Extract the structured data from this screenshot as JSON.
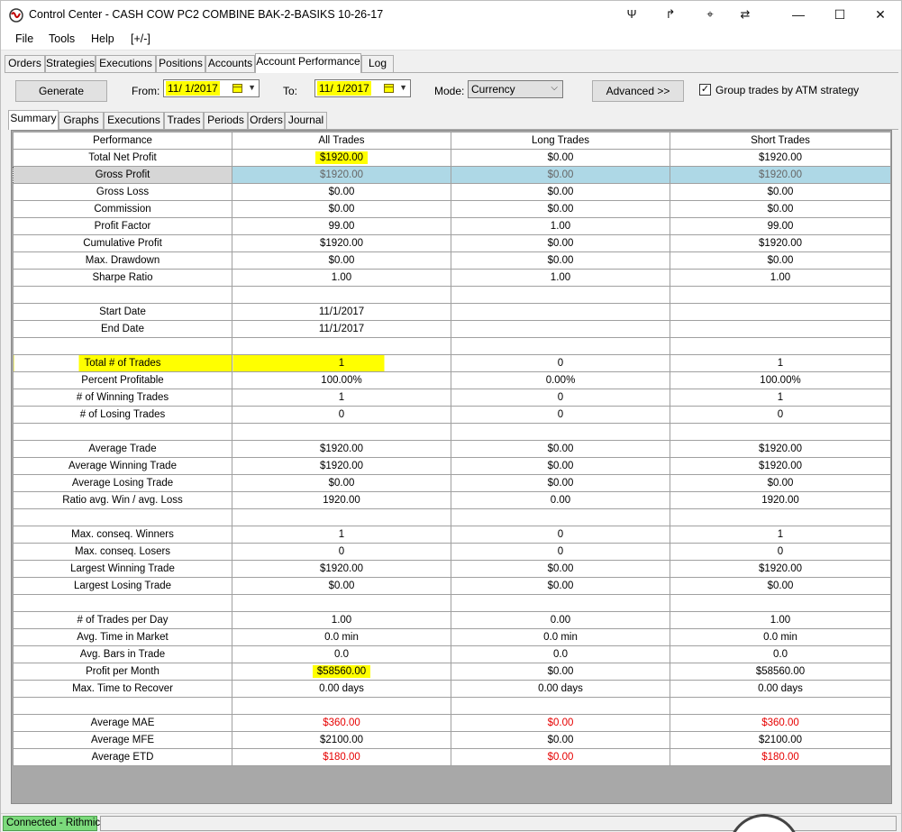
{
  "window": {
    "title": "Control Center - CASH COW PC2 COMBINE BAK-2-BASIKS 10-26-17",
    "tools": [
      "Ψ",
      "↱",
      "⌖",
      "⇄"
    ],
    "controls": {
      "minimize": "—",
      "maximize": "☐",
      "close": "✕"
    }
  },
  "menu": [
    "File",
    "Tools",
    "Help",
    "[+/-]"
  ],
  "main_tabs": [
    "Orders",
    "Strategies",
    "Executions",
    "Positions",
    "Accounts",
    "Account Performance",
    "Log"
  ],
  "toolbar": {
    "generate": "Generate",
    "from_label": "From:",
    "from_value": "11/ 1/2017",
    "to_label": "To:",
    "to_value": "11/ 1/2017",
    "mode_label": "Mode:",
    "mode_value": "Currency",
    "advanced": "Advanced >>",
    "group_label": "Group trades by ATM strategy",
    "group_checked": "✓"
  },
  "sub_tabs": [
    "Summary",
    "Graphs",
    "Executions",
    "Trades",
    "Periods",
    "Orders",
    "Journal"
  ],
  "table": {
    "headers": [
      "Performance",
      "All Trades",
      "Long Trades",
      "Short Trades"
    ],
    "rows": [
      [
        "Total Net Profit",
        "$1920.00",
        "$0.00",
        "$1920.00"
      ],
      [
        "Gross Profit",
        "$1920.00",
        "$0.00",
        "$1920.00"
      ],
      [
        "Gross Loss",
        "$0.00",
        "$0.00",
        "$0.00"
      ],
      [
        "Commission",
        "$0.00",
        "$0.00",
        "$0.00"
      ],
      [
        "Profit Factor",
        "99.00",
        "1.00",
        "99.00"
      ],
      [
        "Cumulative Profit",
        "$1920.00",
        "$0.00",
        "$1920.00"
      ],
      [
        "Max. Drawdown",
        "$0.00",
        "$0.00",
        "$0.00"
      ],
      [
        "Sharpe Ratio",
        "1.00",
        "1.00",
        "1.00"
      ],
      [
        "",
        "",
        "",
        ""
      ],
      [
        "Start Date",
        "11/1/2017",
        "",
        ""
      ],
      [
        "End Date",
        "11/1/2017",
        "",
        ""
      ],
      [
        "",
        "",
        "",
        ""
      ],
      [
        "Total # of Trades",
        "1",
        "0",
        "1"
      ],
      [
        "Percent Profitable",
        "100.00%",
        "0.00%",
        "100.00%"
      ],
      [
        "# of Winning Trades",
        "1",
        "0",
        "1"
      ],
      [
        "# of Losing Trades",
        "0",
        "0",
        "0"
      ],
      [
        "",
        "",
        "",
        ""
      ],
      [
        "Average Trade",
        "$1920.00",
        "$0.00",
        "$1920.00"
      ],
      [
        "Average Winning Trade",
        "$1920.00",
        "$0.00",
        "$1920.00"
      ],
      [
        "Average Losing Trade",
        "$0.00",
        "$0.00",
        "$0.00"
      ],
      [
        "Ratio avg. Win / avg. Loss",
        "1920.00",
        "0.00",
        "1920.00"
      ],
      [
        "",
        "",
        "",
        ""
      ],
      [
        "Max. conseq. Winners",
        "1",
        "0",
        "1"
      ],
      [
        "Max. conseq. Losers",
        "0",
        "0",
        "0"
      ],
      [
        "Largest Winning Trade",
        "$1920.00",
        "$0.00",
        "$1920.00"
      ],
      [
        "Largest Losing Trade",
        "$0.00",
        "$0.00",
        "$0.00"
      ],
      [
        "",
        "",
        "",
        ""
      ],
      [
        "# of Trades per Day",
        "1.00",
        "0.00",
        "1.00"
      ],
      [
        "Avg. Time in Market",
        "0.0 min",
        "0.0 min",
        "0.0 min"
      ],
      [
        "Avg. Bars in Trade",
        "0.0",
        "0.0",
        "0.0"
      ],
      [
        "Profit per Month",
        "$58560.00",
        "$0.00",
        "$58560.00"
      ],
      [
        "Max. Time to Recover",
        "0.00 days",
        "0.00 days",
        "0.00 days"
      ],
      [
        "",
        "",
        "",
        ""
      ],
      [
        "Average MAE",
        "$360.00",
        "$0.00",
        "$360.00"
      ],
      [
        "Average MFE",
        "$2100.00",
        "$0.00",
        "$2100.00"
      ],
      [
        "Average ETD",
        "$180.00",
        "$0.00",
        "$180.00"
      ]
    ]
  },
  "status": {
    "connection": "Connected - Rithmic"
  },
  "colors": {
    "highlight": "#ffff00",
    "selected_row": "#aed8e6",
    "negative": "#e60000",
    "connected": "#7cda7c"
  }
}
